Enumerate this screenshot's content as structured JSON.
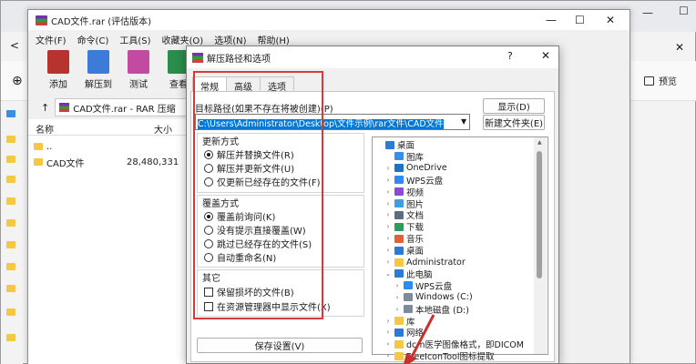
{
  "explorer": {
    "tab_title": "CAD文件.rar (评估版本)",
    "preview_label": "预览"
  },
  "rar": {
    "title": "CAD文件.rar (评估版本)",
    "menu": [
      "文件(F)",
      "命令(C)",
      "工具(S)",
      "收藏夹(O)",
      "选项(N)",
      "帮助(H)"
    ],
    "tools": [
      {
        "label": "添加",
        "color": "#b7342e"
      },
      {
        "label": "解压到",
        "color": "#3d7bd8"
      },
      {
        "label": "测试",
        "color": "#c24aa0"
      },
      {
        "label": "查看",
        "color": "#2a8d4b"
      }
    ],
    "address": "CAD文件.rar - RAR 压缩",
    "columns": {
      "name": "名称",
      "size": "大小"
    },
    "rows": [
      {
        "name": "..",
        "size": ""
      },
      {
        "name": "CAD文件",
        "size": "28,480,331"
      }
    ]
  },
  "dialog": {
    "title": "解压路径和选项",
    "help": "?",
    "close": "✕",
    "tabs": [
      "常规",
      "高级",
      "选项"
    ],
    "target_label": "目标路径(如果不存在将被创建)(P)",
    "target_path": "C:\\Users\\Administrator\\Desktop\\文件示例\\rar文件\\CAD文件",
    "show_button": "显示(D)",
    "new_folder_button": "新建文件夹(E)",
    "update_group": {
      "title": "更新方式",
      "options": [
        {
          "label": "解压并替换文件(R)",
          "checked": true
        },
        {
          "label": "解压并更新文件(U)",
          "checked": false
        },
        {
          "label": "仅更新已经存在的文件(F)",
          "checked": false
        }
      ]
    },
    "overwrite_group": {
      "title": "覆盖方式",
      "options": [
        {
          "label": "覆盖前询问(K)",
          "checked": true
        },
        {
          "label": "没有提示直接覆盖(W)",
          "checked": false
        },
        {
          "label": "跳过已经存在的文件(S)",
          "checked": false
        },
        {
          "label": "自动重命名(N)",
          "checked": false
        }
      ]
    },
    "misc_group": {
      "title": "其它",
      "options": [
        {
          "label": "保留损坏的文件(B)",
          "checked": false
        },
        {
          "label": "在资源管理器中显示文件(X)",
          "checked": false
        }
      ]
    },
    "save_button": "保存设置(V)",
    "tree": [
      {
        "label": "桌面",
        "level": 0,
        "exp": "",
        "icon": "#2b7bd6"
      },
      {
        "label": "图库",
        "level": 1,
        "exp": "",
        "icon": "#3a8ee6"
      },
      {
        "label": "OneDrive",
        "level": 1,
        "exp": ">",
        "icon": "#1e73c8"
      },
      {
        "label": "WPS云盘",
        "level": 1,
        "exp": ">",
        "icon": "#2d8cf0"
      },
      {
        "label": "视频",
        "level": 1,
        "exp": ">",
        "icon": "#8a4bd8"
      },
      {
        "label": "图片",
        "level": 1,
        "exp": ">",
        "icon": "#3aa0e6"
      },
      {
        "label": "文档",
        "level": 1,
        "exp": ">",
        "icon": "#5b6d85"
      },
      {
        "label": "下载",
        "level": 1,
        "exp": ">",
        "icon": "#2a9d5c"
      },
      {
        "label": "音乐",
        "level": 1,
        "exp": ">",
        "icon": "#e0623c"
      },
      {
        "label": "桌面",
        "level": 1,
        "exp": ">",
        "icon": "#2b7bd6"
      },
      {
        "label": "Administrator",
        "level": 1,
        "exp": ">",
        "icon": "#f4c842"
      },
      {
        "label": "此电脑",
        "level": 1,
        "exp": "v",
        "icon": "#2b7bd6"
      },
      {
        "label": "WPS云盘",
        "level": 2,
        "exp": ">",
        "icon": "#2d8cf0"
      },
      {
        "label": "Windows (C:)",
        "level": 2,
        "exp": ">",
        "icon": "#7d8a99"
      },
      {
        "label": "本地磁盘 (D:)",
        "level": 2,
        "exp": ">",
        "icon": "#7d8a99"
      },
      {
        "label": "库",
        "level": 1,
        "exp": ">",
        "icon": "#f4c842"
      },
      {
        "label": "网络",
        "level": 1,
        "exp": ">",
        "icon": "#2b7bd6"
      },
      {
        "label": "dcm医学图像格式，即DICOM",
        "level": 1,
        "exp": ">",
        "icon": "#f4c842"
      },
      {
        "label": "FreeIconTool图标提取",
        "level": 1,
        "exp": ">",
        "icon": "#f4c842"
      }
    ]
  },
  "colors": {
    "highlight_border": "#d8393a",
    "selection": "#0078d7",
    "arrow": "#c9302c"
  }
}
